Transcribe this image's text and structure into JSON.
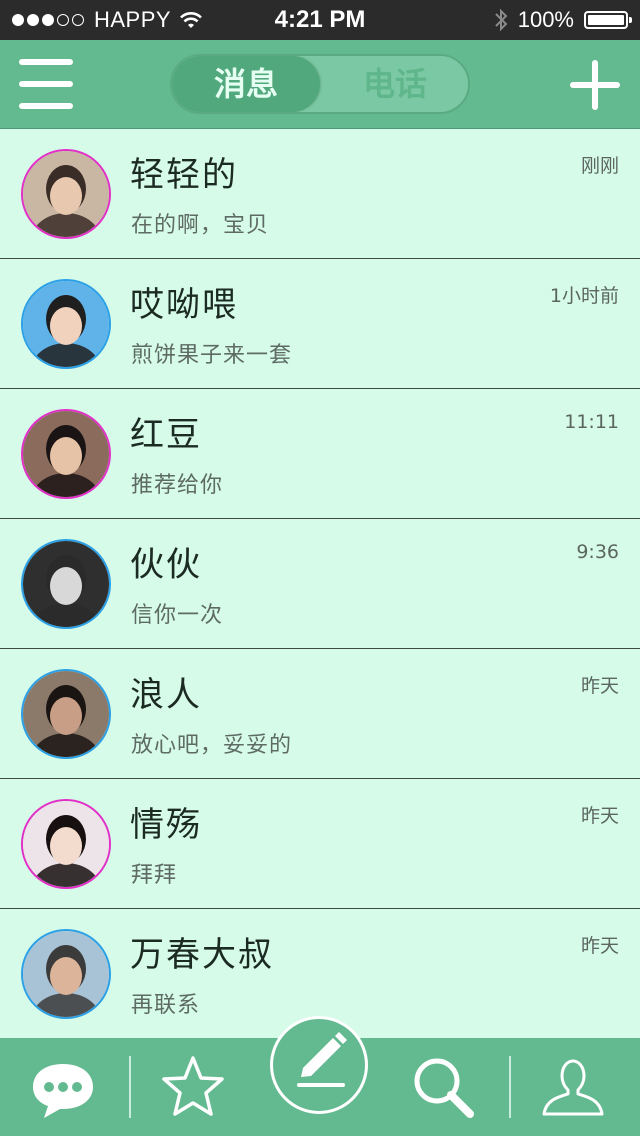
{
  "status_bar": {
    "carrier": "HAPPY",
    "time": "4:21 PM",
    "battery": "100%"
  },
  "header": {
    "tabs": [
      {
        "label": "消息",
        "active": true
      },
      {
        "label": "电话",
        "active": false
      }
    ]
  },
  "conversations": [
    {
      "name": "轻轻的",
      "message": "在的啊，宝贝",
      "time": "刚刚",
      "ring_color": "#e22fc7"
    },
    {
      "name": "哎呦喂",
      "message": "煎饼果子来一套",
      "time": "1小时前",
      "ring_color": "#2ba0e6"
    },
    {
      "name": "红豆",
      "message": "推荐给你",
      "time": "11:11",
      "ring_color": "#e22fc7"
    },
    {
      "name": "伙伙",
      "message": "信你一次",
      "time": "9:36",
      "ring_color": "#2ba0e6"
    },
    {
      "name": "浪人",
      "message": "放心吧，妥妥的",
      "time": "昨天",
      "ring_color": "#2ba0e6"
    },
    {
      "name": "情殇",
      "message": "拜拜",
      "time": "昨天",
      "ring_color": "#e22fc7"
    },
    {
      "name": "万春大叔",
      "message": "再联系",
      "time": "昨天",
      "ring_color": "#2ba0e6"
    }
  ],
  "tab_bar": {
    "items": [
      "chat-bubble-icon",
      "star-icon",
      "pencil-icon",
      "search-icon",
      "user-icon"
    ]
  },
  "colors": {
    "accent": "#64ba90",
    "list_bg": "#d6fbe9",
    "status_bar": "#2b2b2b"
  }
}
